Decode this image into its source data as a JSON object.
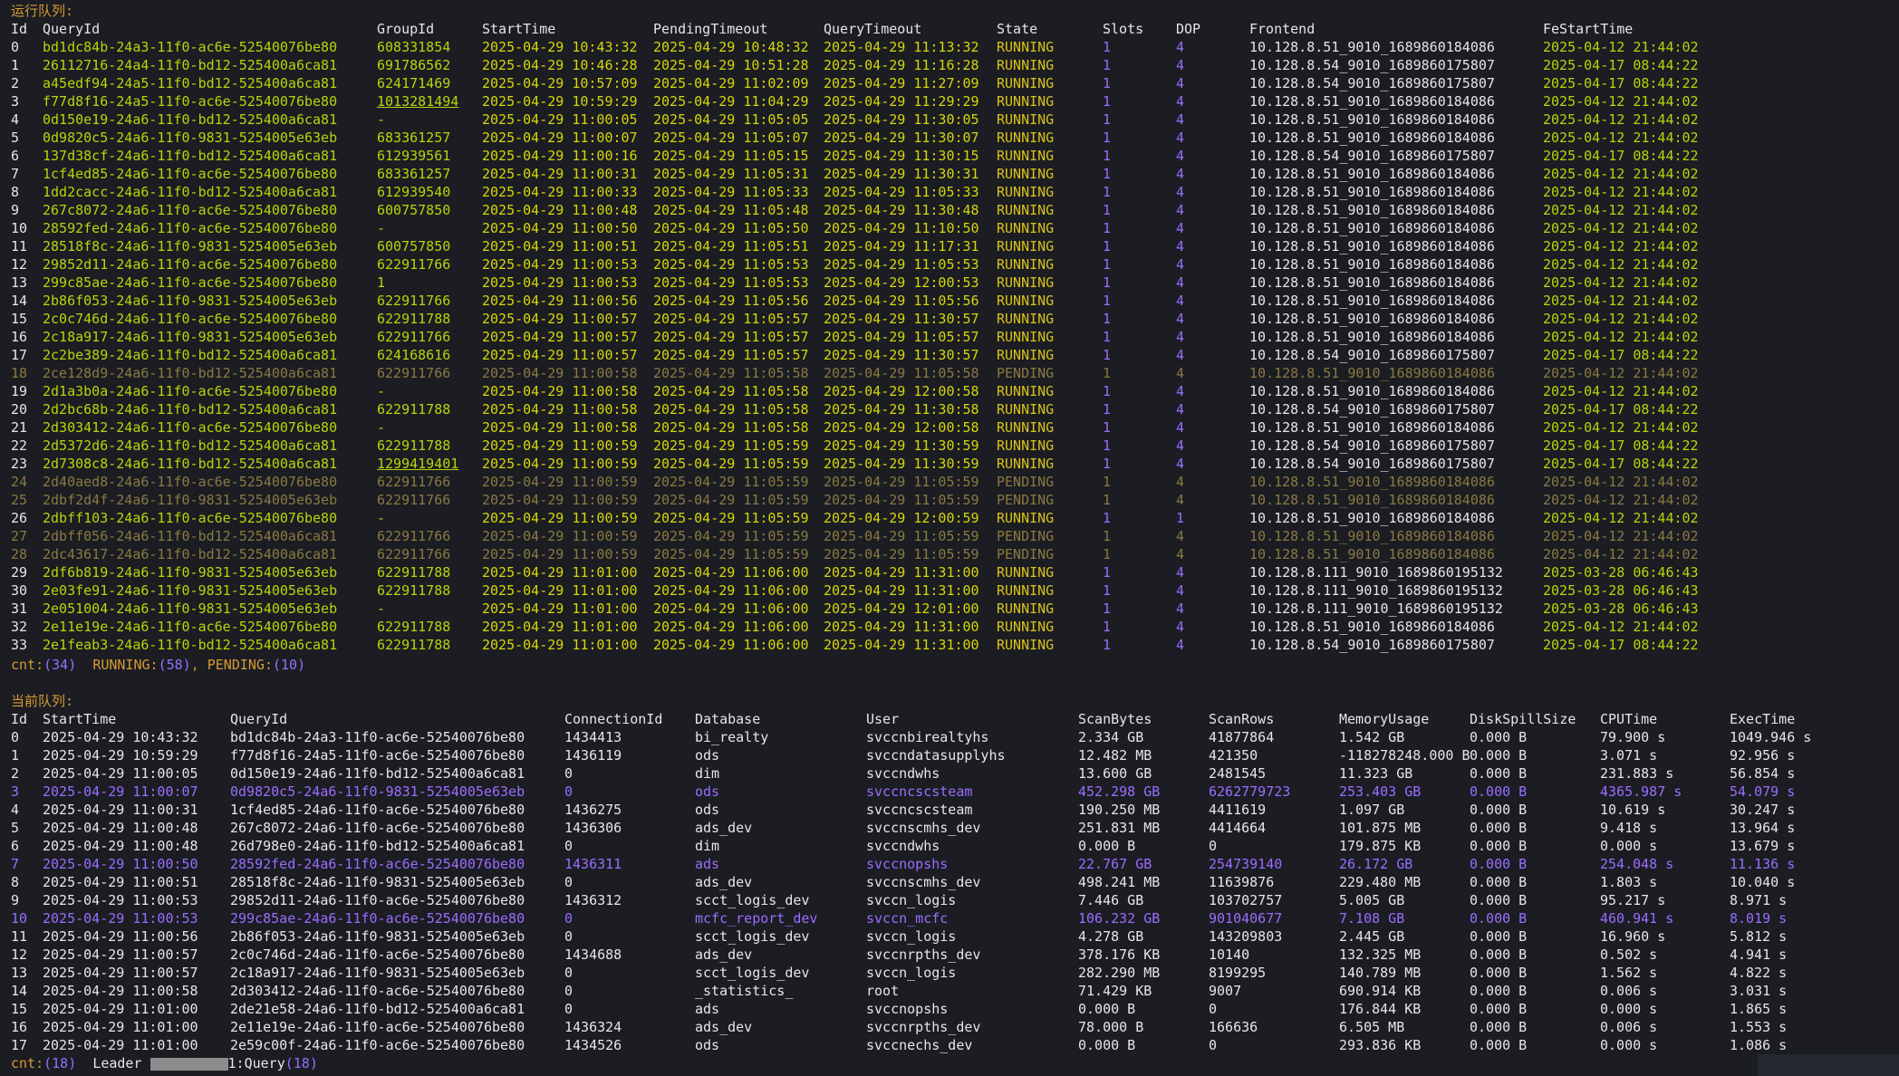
{
  "running_title": "运行队列:",
  "running_headers": [
    "Id",
    "QueryId",
    "GroupId",
    "StartTime",
    "PendingTimeout",
    "QueryTimeout",
    "State",
    "Slots",
    "DOP",
    "Frontend",
    "FeStartTime"
  ],
  "running_rows": [
    [
      "0",
      "bd1dc84b-24a3-11f0-ac6e-52540076be80",
      "608331854",
      "2025-04-29 10:43:32",
      "2025-04-29 10:48:32",
      "2025-04-29 11:13:32",
      "RUNNING",
      "1",
      "4",
      "10.128.8.51_9010_1689860184086",
      "2025-04-12 21:44:02"
    ],
    [
      "1",
      "26112716-24a4-11f0-bd12-525400a6ca81",
      "691786562",
      "2025-04-29 10:46:28",
      "2025-04-29 10:51:28",
      "2025-04-29 11:16:28",
      "RUNNING",
      "1",
      "4",
      "10.128.8.54_9010_1689860175807",
      "2025-04-17 08:44:22"
    ],
    [
      "2",
      "a45edf94-24a5-11f0-bd12-525400a6ca81",
      "624171469",
      "2025-04-29 10:57:09",
      "2025-04-29 11:02:09",
      "2025-04-29 11:27:09",
      "RUNNING",
      "1",
      "4",
      "10.128.8.54_9010_1689860175807",
      "2025-04-17 08:44:22"
    ],
    [
      "3",
      "f77d8f16-24a5-11f0-ac6e-52540076be80",
      "1013281494",
      "2025-04-29 10:59:29",
      "2025-04-29 11:04:29",
      "2025-04-29 11:29:29",
      "RUNNING",
      "1",
      "4",
      "10.128.8.51_9010_1689860184086",
      "2025-04-12 21:44:02"
    ],
    [
      "4",
      "0d150e19-24a6-11f0-bd12-525400a6ca81",
      "-",
      "2025-04-29 11:00:05",
      "2025-04-29 11:05:05",
      "2025-04-29 11:30:05",
      "RUNNING",
      "1",
      "4",
      "10.128.8.51_9010_1689860184086",
      "2025-04-12 21:44:02"
    ],
    [
      "5",
      "0d9820c5-24a6-11f0-9831-5254005e63eb",
      "683361257",
      "2025-04-29 11:00:07",
      "2025-04-29 11:05:07",
      "2025-04-29 11:30:07",
      "RUNNING",
      "1",
      "4",
      "10.128.8.51_9010_1689860184086",
      "2025-04-12 21:44:02"
    ],
    [
      "6",
      "137d38cf-24a6-11f0-bd12-525400a6ca81",
      "612939561",
      "2025-04-29 11:00:16",
      "2025-04-29 11:05:15",
      "2025-04-29 11:30:15",
      "RUNNING",
      "1",
      "4",
      "10.128.8.54_9010_1689860175807",
      "2025-04-17 08:44:22"
    ],
    [
      "7",
      "1cf4ed85-24a6-11f0-ac6e-52540076be80",
      "683361257",
      "2025-04-29 11:00:31",
      "2025-04-29 11:05:31",
      "2025-04-29 11:30:31",
      "RUNNING",
      "1",
      "4",
      "10.128.8.51_9010_1689860184086",
      "2025-04-12 21:44:02"
    ],
    [
      "8",
      "1dd2cacc-24a6-11f0-bd12-525400a6ca81",
      "612939540",
      "2025-04-29 11:00:33",
      "2025-04-29 11:05:33",
      "2025-04-29 11:05:33",
      "RUNNING",
      "1",
      "4",
      "10.128.8.51_9010_1689860184086",
      "2025-04-12 21:44:02"
    ],
    [
      "9",
      "267c8072-24a6-11f0-ac6e-52540076be80",
      "600757850",
      "2025-04-29 11:00:48",
      "2025-04-29 11:05:48",
      "2025-04-29 11:30:48",
      "RUNNING",
      "1",
      "4",
      "10.128.8.51_9010_1689860184086",
      "2025-04-12 21:44:02"
    ],
    [
      "10",
      "28592fed-24a6-11f0-ac6e-52540076be80",
      "-",
      "2025-04-29 11:00:50",
      "2025-04-29 11:05:50",
      "2025-04-29 11:10:50",
      "RUNNING",
      "1",
      "4",
      "10.128.8.51_9010_1689860184086",
      "2025-04-12 21:44:02"
    ],
    [
      "11",
      "28518f8c-24a6-11f0-9831-5254005e63eb",
      "600757850",
      "2025-04-29 11:00:51",
      "2025-04-29 11:05:51",
      "2025-04-29 11:17:31",
      "RUNNING",
      "1",
      "4",
      "10.128.8.51_9010_1689860184086",
      "2025-04-12 21:44:02"
    ],
    [
      "12",
      "29852d11-24a6-11f0-ac6e-52540076be80",
      "622911766",
      "2025-04-29 11:00:53",
      "2025-04-29 11:05:53",
      "2025-04-29 11:05:53",
      "RUNNING",
      "1",
      "4",
      "10.128.8.51_9010_1689860184086",
      "2025-04-12 21:44:02"
    ],
    [
      "13",
      "299c85ae-24a6-11f0-ac6e-52540076be80",
      "1",
      "2025-04-29 11:00:53",
      "2025-04-29 11:05:53",
      "2025-04-29 12:00:53",
      "RUNNING",
      "1",
      "4",
      "10.128.8.51_9010_1689860184086",
      "2025-04-12 21:44:02"
    ],
    [
      "14",
      "2b86f053-24a6-11f0-9831-5254005e63eb",
      "622911766",
      "2025-04-29 11:00:56",
      "2025-04-29 11:05:56",
      "2025-04-29 11:05:56",
      "RUNNING",
      "1",
      "4",
      "10.128.8.51_9010_1689860184086",
      "2025-04-12 21:44:02"
    ],
    [
      "15",
      "2c0c746d-24a6-11f0-ac6e-52540076be80",
      "622911788",
      "2025-04-29 11:00:57",
      "2025-04-29 11:05:57",
      "2025-04-29 11:30:57",
      "RUNNING",
      "1",
      "4",
      "10.128.8.51_9010_1689860184086",
      "2025-04-12 21:44:02"
    ],
    [
      "16",
      "2c18a917-24a6-11f0-9831-5254005e63eb",
      "622911766",
      "2025-04-29 11:00:57",
      "2025-04-29 11:05:57",
      "2025-04-29 11:05:57",
      "RUNNING",
      "1",
      "4",
      "10.128.8.51_9010_1689860184086",
      "2025-04-12 21:44:02"
    ],
    [
      "17",
      "2c2be389-24a6-11f0-bd12-525400a6ca81",
      "624168616",
      "2025-04-29 11:00:57",
      "2025-04-29 11:05:57",
      "2025-04-29 11:30:57",
      "RUNNING",
      "1",
      "4",
      "10.128.8.54_9010_1689860175807",
      "2025-04-17 08:44:22"
    ],
    [
      "18",
      "2ce128d9-24a6-11f0-bd12-525400a6ca81",
      "622911766",
      "2025-04-29 11:00:58",
      "2025-04-29 11:05:58",
      "2025-04-29 11:05:58",
      "PENDING",
      "1",
      "4",
      "10.128.8.51_9010_1689860184086",
      "2025-04-12 21:44:02"
    ],
    [
      "19",
      "2d1a3b0a-24a6-11f0-ac6e-52540076be80",
      "-",
      "2025-04-29 11:00:58",
      "2025-04-29 11:05:58",
      "2025-04-29 12:00:58",
      "RUNNING",
      "1",
      "4",
      "10.128.8.51_9010_1689860184086",
      "2025-04-12 21:44:02"
    ],
    [
      "20",
      "2d2bc68b-24a6-11f0-bd12-525400a6ca81",
      "622911788",
      "2025-04-29 11:00:58",
      "2025-04-29 11:05:58",
      "2025-04-29 11:30:58",
      "RUNNING",
      "1",
      "4",
      "10.128.8.54_9010_1689860175807",
      "2025-04-17 08:44:22"
    ],
    [
      "21",
      "2d303412-24a6-11f0-ac6e-52540076be80",
      "-",
      "2025-04-29 11:00:58",
      "2025-04-29 11:05:58",
      "2025-04-29 12:00:58",
      "RUNNING",
      "1",
      "4",
      "10.128.8.51_9010_1689860184086",
      "2025-04-12 21:44:02"
    ],
    [
      "22",
      "2d5372d6-24a6-11f0-bd12-525400a6ca81",
      "622911788",
      "2025-04-29 11:00:59",
      "2025-04-29 11:05:59",
      "2025-04-29 11:30:59",
      "RUNNING",
      "1",
      "4",
      "10.128.8.54_9010_1689860175807",
      "2025-04-17 08:44:22"
    ],
    [
      "23",
      "2d7308c8-24a6-11f0-bd12-525400a6ca81",
      "1299419401",
      "2025-04-29 11:00:59",
      "2025-04-29 11:05:59",
      "2025-04-29 11:30:59",
      "RUNNING",
      "1",
      "4",
      "10.128.8.54_9010_1689860175807",
      "2025-04-17 08:44:22"
    ],
    [
      "24",
      "2d40aed8-24a6-11f0-ac6e-52540076be80",
      "622911766",
      "2025-04-29 11:00:59",
      "2025-04-29 11:05:59",
      "2025-04-29 11:05:59",
      "PENDING",
      "1",
      "4",
      "10.128.8.51_9010_1689860184086",
      "2025-04-12 21:44:02"
    ],
    [
      "25",
      "2dbf2d4f-24a6-11f0-9831-5254005e63eb",
      "622911766",
      "2025-04-29 11:00:59",
      "2025-04-29 11:05:59",
      "2025-04-29 11:05:59",
      "PENDING",
      "1",
      "4",
      "10.128.8.51_9010_1689860184086",
      "2025-04-12 21:44:02"
    ],
    [
      "26",
      "2dbff103-24a6-11f0-ac6e-52540076be80",
      "-",
      "2025-04-29 11:00:59",
      "2025-04-29 11:05:59",
      "2025-04-29 12:00:59",
      "RUNNING",
      "1",
      "1",
      "10.128.8.51_9010_1689860184086",
      "2025-04-12 21:44:02"
    ],
    [
      "27",
      "2dbff056-24a6-11f0-bd12-525400a6ca81",
      "622911766",
      "2025-04-29 11:00:59",
      "2025-04-29 11:05:59",
      "2025-04-29 11:05:59",
      "PENDING",
      "1",
      "4",
      "10.128.8.51_9010_1689860184086",
      "2025-04-12 21:44:02"
    ],
    [
      "28",
      "2dc43617-24a6-11f0-bd12-525400a6ca81",
      "622911766",
      "2025-04-29 11:00:59",
      "2025-04-29 11:05:59",
      "2025-04-29 11:05:59",
      "PENDING",
      "1",
      "4",
      "10.128.8.51_9010_1689860184086",
      "2025-04-12 21:44:02"
    ],
    [
      "29",
      "2df6b819-24a6-11f0-9831-5254005e63eb",
      "622911788",
      "2025-04-29 11:01:00",
      "2025-04-29 11:06:00",
      "2025-04-29 11:31:00",
      "RUNNING",
      "1",
      "4",
      "10.128.8.111_9010_1689860195132",
      "2025-03-28 06:46:43"
    ],
    [
      "30",
      "2e03fe91-24a6-11f0-9831-5254005e63eb",
      "622911788",
      "2025-04-29 11:01:00",
      "2025-04-29 11:06:00",
      "2025-04-29 11:31:00",
      "RUNNING",
      "1",
      "4",
      "10.128.8.111_9010_1689860195132",
      "2025-03-28 06:46:43"
    ],
    [
      "31",
      "2e051004-24a6-11f0-9831-5254005e63eb",
      "-",
      "2025-04-29 11:01:00",
      "2025-04-29 11:06:00",
      "2025-04-29 12:01:00",
      "RUNNING",
      "1",
      "4",
      "10.128.8.111_9010_1689860195132",
      "2025-03-28 06:46:43"
    ],
    [
      "32",
      "2e11e19e-24a6-11f0-ac6e-52540076be80",
      "622911788",
      "2025-04-29 11:01:00",
      "2025-04-29 11:06:00",
      "2025-04-29 11:31:00",
      "RUNNING",
      "1",
      "4",
      "10.128.8.51_9010_1689860184086",
      "2025-04-12 21:44:02"
    ],
    [
      "33",
      "2e1feab3-24a6-11f0-bd12-525400a6ca81",
      "622911788",
      "2025-04-29 11:01:00",
      "2025-04-29 11:06:00",
      "2025-04-29 11:31:00",
      "RUNNING",
      "1",
      "4",
      "10.128.8.54_9010_1689860175807",
      "2025-04-17 08:44:22"
    ]
  ],
  "running_summary": {
    "cnt_label": "cnt:",
    "cnt": "(34)",
    "running_label": "RUNNING:",
    "running": "(58)",
    "pending_label": ", PENDING:",
    "pending": "(10)"
  },
  "current_title": "当前队列:",
  "current_headers": [
    "Id",
    "StartTime",
    "QueryId",
    "ConnectionId",
    "Database",
    "User",
    "ScanBytes",
    "ScanRows",
    "MemoryUsage",
    "DiskSpillSize",
    "CPUTime",
    "ExecTime"
  ],
  "current_rows": [
    [
      "0",
      "2025-04-29 10:43:32",
      "bd1dc84b-24a3-11f0-ac6e-52540076be80",
      "1434413",
      "bi_realty",
      "svccnbirealtyhs",
      "2.334 GB",
      "41877864",
      "1.542 GB",
      "0.000 B",
      "79.900 s",
      "1049.946 s"
    ],
    [
      "1",
      "2025-04-29 10:59:29",
      "f77d8f16-24a5-11f0-ac6e-52540076be80",
      "1436119",
      "ods",
      "svccndatasupplyhs",
      "12.482 MB",
      "421350",
      "-118278248.000 B",
      "0.000 B",
      "3.071 s",
      "92.956 s"
    ],
    [
      "2",
      "2025-04-29 11:00:05",
      "0d150e19-24a6-11f0-bd12-525400a6ca81",
      "0",
      "dim",
      "svccndwhs",
      "13.600 GB",
      "2481545",
      "11.323 GB",
      "0.000 B",
      "231.883 s",
      "56.854 s"
    ],
    [
      "3",
      "2025-04-29 11:00:07",
      "0d9820c5-24a6-11f0-9831-5254005e63eb",
      "0",
      "ods",
      "svccncscsteam",
      "452.298 GB",
      "6262779723",
      "253.403 GB",
      "0.000 B",
      "4365.987 s",
      "54.079 s"
    ],
    [
      "4",
      "2025-04-29 11:00:31",
      "1cf4ed85-24a6-11f0-ac6e-52540076be80",
      "1436275",
      "ods",
      "svccncscsteam",
      "190.250 MB",
      "4411619",
      "1.097 GB",
      "0.000 B",
      "10.619 s",
      "30.247 s"
    ],
    [
      "5",
      "2025-04-29 11:00:48",
      "267c8072-24a6-11f0-ac6e-52540076be80",
      "1436306",
      "ads_dev",
      "svccnscmhs_dev",
      "251.831 MB",
      "4414664",
      "101.875 MB",
      "0.000 B",
      "9.418 s",
      "13.964 s"
    ],
    [
      "6",
      "2025-04-29 11:00:48",
      "26d798e0-24a6-11f0-bd12-525400a6ca81",
      "0",
      "dim",
      "svccndwhs",
      "0.000 B",
      "0",
      "179.875 KB",
      "0.000 B",
      "0.000 s",
      "13.679 s"
    ],
    [
      "7",
      "2025-04-29 11:00:50",
      "28592fed-24a6-11f0-ac6e-52540076be80",
      "1436311",
      "ads",
      "svccnopshs",
      "22.767 GB",
      "254739140",
      "26.172 GB",
      "0.000 B",
      "254.048 s",
      "11.136 s"
    ],
    [
      "8",
      "2025-04-29 11:00:51",
      "28518f8c-24a6-11f0-9831-5254005e63eb",
      "0",
      "ads_dev",
      "svccnscmhs_dev",
      "498.241 MB",
      "11639876",
      "229.480 MB",
      "0.000 B",
      "1.803 s",
      "10.040 s"
    ],
    [
      "9",
      "2025-04-29 11:00:53",
      "29852d11-24a6-11f0-ac6e-52540076be80",
      "1436312",
      "scct_logis_dev",
      "svccn_logis",
      "7.446 GB",
      "103702757",
      "5.005 GB",
      "0.000 B",
      "95.217 s",
      "8.971 s"
    ],
    [
      "10",
      "2025-04-29 11:00:53",
      "299c85ae-24a6-11f0-ac6e-52540076be80",
      "0",
      "mcfc_report_dev",
      "svccn_mcfc",
      "106.232 GB",
      "901040677",
      "7.108 GB",
      "0.000 B",
      "460.941 s",
      "8.019 s"
    ],
    [
      "11",
      "2025-04-29 11:00:56",
      "2b86f053-24a6-11f0-9831-5254005e63eb",
      "0",
      "scct_logis_dev",
      "svccn_logis",
      "4.278 GB",
      "143209803",
      "2.445 GB",
      "0.000 B",
      "16.960 s",
      "5.812 s"
    ],
    [
      "12",
      "2025-04-29 11:00:57",
      "2c0c746d-24a6-11f0-ac6e-52540076be80",
      "1434688",
      "ads_dev",
      "svccnrpths_dev",
      "378.176 KB",
      "10140",
      "132.325 MB",
      "0.000 B",
      "0.502 s",
      "4.941 s"
    ],
    [
      "13",
      "2025-04-29 11:00:57",
      "2c18a917-24a6-11f0-9831-5254005e63eb",
      "0",
      "scct_logis_dev",
      "svccn_logis",
      "282.290 MB",
      "8199295",
      "140.789 MB",
      "0.000 B",
      "1.562 s",
      "4.822 s"
    ],
    [
      "14",
      "2025-04-29 11:00:58",
      "2d303412-24a6-11f0-ac6e-52540076be80",
      "0",
      "_statistics_",
      "root",
      "71.429 KB",
      "9007",
      "690.914 KB",
      "0.000 B",
      "0.006 s",
      "3.031 s"
    ],
    [
      "15",
      "2025-04-29 11:01:00",
      "2de21e58-24a6-11f0-bd12-525400a6ca81",
      "0",
      "ads",
      "svccnopshs",
      "0.000 B",
      "0",
      "176.844 KB",
      "0.000 B",
      "0.000 s",
      "1.865 s"
    ],
    [
      "16",
      "2025-04-29 11:01:00",
      "2e11e19e-24a6-11f0-ac6e-52540076be80",
      "1436324",
      "ads_dev",
      "svccnrpths_dev",
      "78.000 B",
      "166636",
      "6.505 MB",
      "0.000 B",
      "0.006 s",
      "1.553 s"
    ],
    [
      "17",
      "2025-04-29 11:01:00",
      "2e59c00f-24a6-11f0-ac6e-52540076be80",
      "1434526",
      "ods",
      "svccnechs_dev",
      "0.000 B",
      "0",
      "293.836 KB",
      "0.000 B",
      "0.000 s",
      "1.086 s"
    ]
  ],
  "current_summary": {
    "cnt_label": "cnt:",
    "cnt": "(18)",
    "leader_label": "Leader",
    "leader_suffix": "1:Query",
    "query": "(18)"
  },
  "colors": {
    "background": "#1b1d23",
    "id": "#e6e6e6",
    "queryid": "#b5d60a",
    "time": "#d6d60a",
    "state": "#d9c21a",
    "pending": "#8a7a40",
    "highlight": "#9b6dff",
    "title": "#d79a32"
  }
}
